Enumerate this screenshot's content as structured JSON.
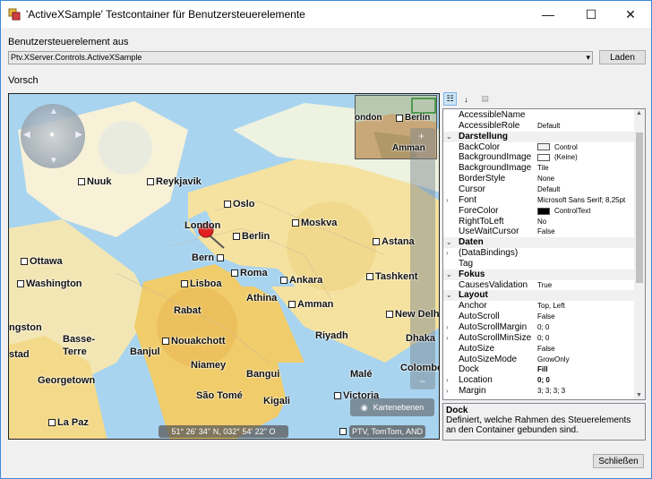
{
  "window": {
    "title": "'ActiveXSample' Testcontainer für Benutzersteuerelemente",
    "minimize": "—",
    "maximize": "☐",
    "close": "✕"
  },
  "control_select": {
    "label": "Benutzersteuerelement aus",
    "value": "Ptv.XServer.Controls.ActiveXSample",
    "load_button": "Laden"
  },
  "preview": {
    "label": "Vorsch",
    "map": {
      "cities": [
        {
          "name": "Nuuk"
        },
        {
          "name": "Reykjavik"
        },
        {
          "name": "Oslo"
        },
        {
          "name": "London"
        },
        {
          "name": "Moskva"
        },
        {
          "name": "Berlin"
        },
        {
          "name": "Astana"
        },
        {
          "name": "Bern"
        },
        {
          "name": "Ottawa"
        },
        {
          "name": "Roma"
        },
        {
          "name": "Washington"
        },
        {
          "name": "Lisboa"
        },
        {
          "name": "Ankara"
        },
        {
          "name": "Tashkent"
        },
        {
          "name": "Athina"
        },
        {
          "name": "Rabat"
        },
        {
          "name": "Amman"
        },
        {
          "name": "New Delhi"
        },
        {
          "name": "ngston"
        },
        {
          "name": "Basse-"
        },
        {
          "name": "Terre"
        },
        {
          "name": "Riyadh"
        },
        {
          "name": "Dhaka"
        },
        {
          "name": "stad"
        },
        {
          "name": "Banjul"
        },
        {
          "name": "Nouakchott"
        },
        {
          "name": "Niamey"
        },
        {
          "name": "Georgetown"
        },
        {
          "name": "Bangui"
        },
        {
          "name": "Malé"
        },
        {
          "name": "Colombo"
        },
        {
          "name": "São Tomé"
        },
        {
          "name": "Kigali"
        },
        {
          "name": "Victoria"
        },
        {
          "name": "La Paz"
        }
      ],
      "minimap_cities": [
        {
          "name": "ondon"
        },
        {
          "name": "Berlin"
        },
        {
          "name": "Amman"
        }
      ],
      "layers_button": "Kartenebenen",
      "coordinates": "51° 26' 34'' N, 032° 54' 22'' O",
      "copyright": "PTV, TomTom, AND"
    }
  },
  "property_grid": {
    "rows": [
      {
        "type": "prop",
        "name": "AccessibleName",
        "value": ""
      },
      {
        "type": "prop",
        "name": "AccessibleRole",
        "value": "Default"
      },
      {
        "type": "cat",
        "name": "Darstellung"
      },
      {
        "type": "prop",
        "name": "BackColor",
        "value": "Control",
        "swatch": "#f0f0f0"
      },
      {
        "type": "prop",
        "name": "BackgroundImage",
        "value": "(Keine)",
        "swatch": "#ffffff"
      },
      {
        "type": "prop",
        "name": "BackgroundImage",
        "value": "Tile"
      },
      {
        "type": "prop",
        "name": "BorderStyle",
        "value": "None"
      },
      {
        "type": "prop",
        "name": "Cursor",
        "value": "Default"
      },
      {
        "type": "prop",
        "name": "Font",
        "value": "Microsoft Sans Serif; 8,25pt",
        "expand": true
      },
      {
        "type": "prop",
        "name": "ForeColor",
        "value": "ControlText",
        "swatch": "#000000"
      },
      {
        "type": "prop",
        "name": "RightToLeft",
        "value": "No"
      },
      {
        "type": "prop",
        "name": "UseWaitCursor",
        "value": "False"
      },
      {
        "type": "cat",
        "name": "Daten"
      },
      {
        "type": "prop",
        "name": "(DataBindings)",
        "value": "",
        "expand": true
      },
      {
        "type": "prop",
        "name": "Tag",
        "value": ""
      },
      {
        "type": "cat",
        "name": "Fokus"
      },
      {
        "type": "prop",
        "name": "CausesValidation",
        "value": "True"
      },
      {
        "type": "cat",
        "name": "Layout"
      },
      {
        "type": "prop",
        "name": "Anchor",
        "value": "Top, Left"
      },
      {
        "type": "prop",
        "name": "AutoScroll",
        "value": "False"
      },
      {
        "type": "prop",
        "name": "AutoScrollMargin",
        "value": "0; 0",
        "expand": true
      },
      {
        "type": "prop",
        "name": "AutoScrollMinSize",
        "value": "0; 0",
        "expand": true
      },
      {
        "type": "prop",
        "name": "AutoSize",
        "value": "False"
      },
      {
        "type": "prop",
        "name": "AutoSizeMode",
        "value": "GrowOnly"
      },
      {
        "type": "prop",
        "name": "Dock",
        "value": "Fill",
        "bold": true
      },
      {
        "type": "prop",
        "name": "Location",
        "value": "0; 0",
        "expand": true,
        "bold": true
      },
      {
        "type": "prop",
        "name": "Margin",
        "value": "3; 3; 3; 3",
        "expand": true
      }
    ]
  },
  "help": {
    "title": "Dock",
    "text": "Definiert, welche Rahmen des Steuerelements an den Container gebunden sind."
  },
  "close_button": "Schließen"
}
